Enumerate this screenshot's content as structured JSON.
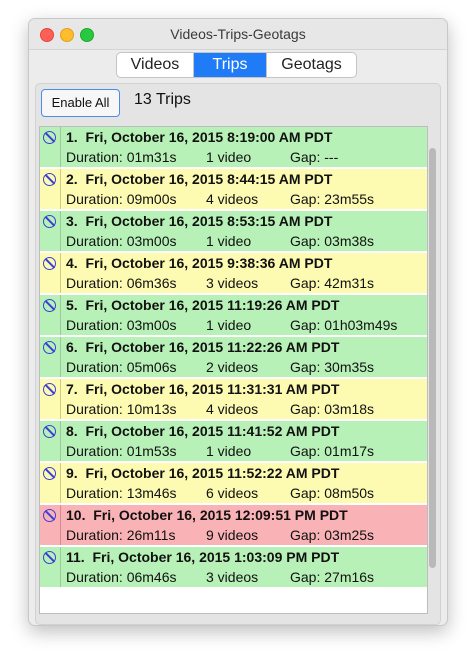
{
  "window": {
    "title": "Videos-Trips-Geotags"
  },
  "tabs": [
    {
      "label": "Videos",
      "active": false
    },
    {
      "label": "Trips",
      "active": true
    },
    {
      "label": "Geotags",
      "active": false
    }
  ],
  "toolbar": {
    "enable_all_label": "Enable All",
    "count_label": "13 Trips"
  },
  "colors": {
    "green": "#b7f1b7",
    "yellow": "#fdfab2",
    "red": "#f9b2b6",
    "accent": "#1f7cf6"
  },
  "trips": [
    {
      "num": "1.",
      "datetime": "Fri, October 16, 2015 8:19:00 AM PDT",
      "duration": "Duration: 01m31s",
      "videos": "1 video",
      "gap": "Gap: ---",
      "color": "green"
    },
    {
      "num": "2.",
      "datetime": "Fri, October 16, 2015 8:44:15 AM PDT",
      "duration": "Duration: 09m00s",
      "videos": "4 videos",
      "gap": "Gap: 23m55s",
      "color": "yellow"
    },
    {
      "num": "3.",
      "datetime": "Fri, October 16, 2015 8:53:15 AM PDT",
      "duration": "Duration: 03m00s",
      "videos": "1 video",
      "gap": "Gap: 03m38s",
      "color": "green"
    },
    {
      "num": "4.",
      "datetime": "Fri, October 16, 2015 9:38:36 AM PDT",
      "duration": "Duration: 06m36s",
      "videos": "3 videos",
      "gap": "Gap: 42m31s",
      "color": "yellow"
    },
    {
      "num": "5.",
      "datetime": "Fri, October 16, 2015 11:19:26 AM PDT",
      "duration": "Duration: 03m00s",
      "videos": "1 video",
      "gap": "Gap: 01h03m49s",
      "color": "green"
    },
    {
      "num": "6.",
      "datetime": "Fri, October 16, 2015 11:22:26 AM PDT",
      "duration": "Duration: 05m06s",
      "videos": "2 videos",
      "gap": "Gap: 30m35s",
      "color": "green"
    },
    {
      "num": "7.",
      "datetime": "Fri, October 16, 2015 11:31:31 AM PDT",
      "duration": "Duration: 10m13s",
      "videos": "4 videos",
      "gap": "Gap: 03m18s",
      "color": "yellow"
    },
    {
      "num": "8.",
      "datetime": "Fri, October 16, 2015 11:41:52 AM PDT",
      "duration": "Duration: 01m53s",
      "videos": "1 video",
      "gap": "Gap: 01m17s",
      "color": "green"
    },
    {
      "num": "9.",
      "datetime": "Fri, October 16, 2015 11:52:22 AM PDT",
      "duration": "Duration: 13m46s",
      "videos": "6 videos",
      "gap": "Gap: 08m50s",
      "color": "yellow"
    },
    {
      "num": "10.",
      "datetime": "Fri, October 16, 2015 12:09:51 PM PDT",
      "duration": "Duration: 26m11s",
      "videos": "9 videos",
      "gap": "Gap: 03m25s",
      "color": "red"
    },
    {
      "num": "11.",
      "datetime": "Fri, October 16, 2015 1:03:09 PM PDT",
      "duration": "Duration: 06m46s",
      "videos": "3 videos",
      "gap": "Gap: 27m16s",
      "color": "green"
    }
  ]
}
